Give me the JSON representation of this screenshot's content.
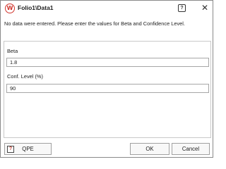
{
  "window": {
    "title": "Folio1\\Data1",
    "app_icon_glyph": "W",
    "help_glyph": "?",
    "close_glyph": "✕"
  },
  "message": "No data were entered. Please enter the values for Beta and Confidence Level.",
  "fields": {
    "beta": {
      "label": "Beta",
      "value": "1.8"
    },
    "conf_level": {
      "label": "Conf. Level (%)",
      "value": "90"
    }
  },
  "buttons": {
    "qpe": "QPE",
    "qpe_icon_glyph": "?",
    "ok": "OK",
    "cancel": "Cancel"
  },
  "colors": {
    "accent_red": "#d0342c"
  }
}
